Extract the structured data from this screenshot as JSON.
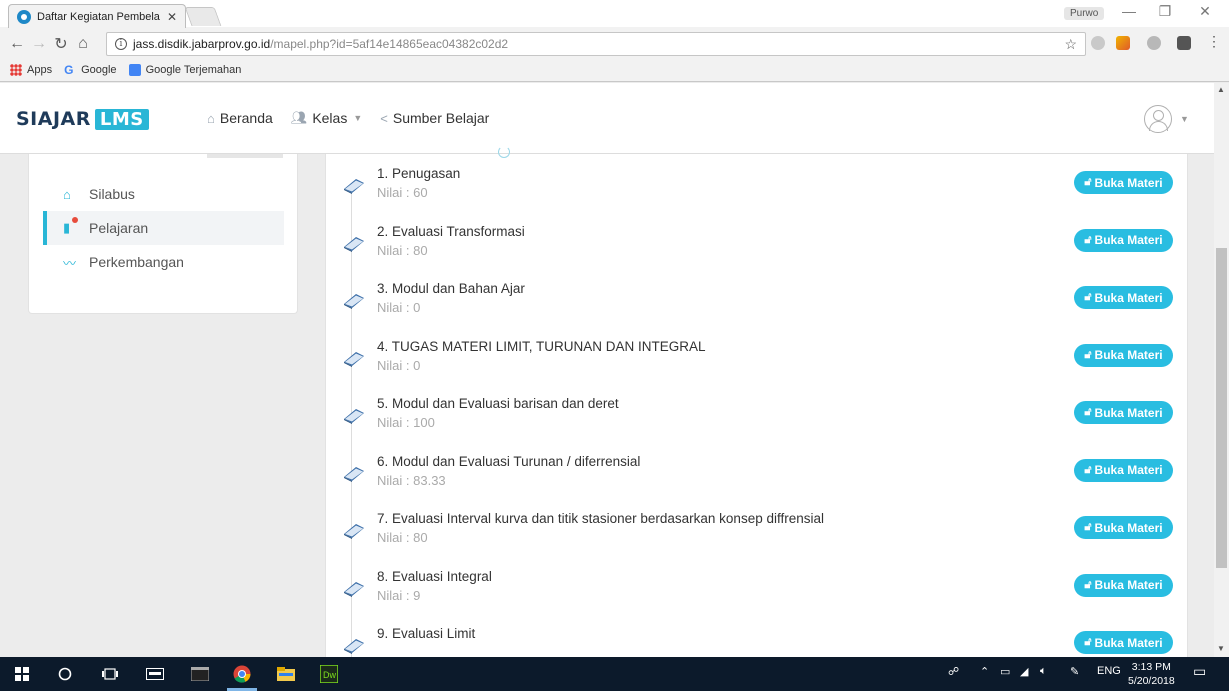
{
  "browser": {
    "tab_title": "Daftar Kegiatan Pembela",
    "tab_close": "✕",
    "user_name": "Purwo",
    "url_host": "jass.disdik.jabarprov.go.id",
    "url_path": "/mapel.php?id=5af14e14865eac04382c02d2",
    "bookmarks": [
      {
        "label": "Apps",
        "icon": "apps-grid-icon"
      },
      {
        "label": "Google",
        "icon": "google-g-icon"
      },
      {
        "label": "Google Terjemahan",
        "icon": "translate-icon"
      }
    ]
  },
  "navbar": {
    "brand_main": "SIAJAR",
    "brand_accent": "LMS",
    "menu": [
      {
        "label": "Beranda",
        "icon": "home-icon"
      },
      {
        "label": "Kelas",
        "icon": "users-icon",
        "dropdown": true
      },
      {
        "label": "Sumber Belajar",
        "icon": "share-icon"
      }
    ]
  },
  "sidebar": {
    "items": [
      {
        "label": "Silabus",
        "icon": "home-icon",
        "active": false
      },
      {
        "label": "Pelajaran",
        "icon": "book-icon",
        "active": true
      },
      {
        "label": "Perkembangan",
        "icon": "activity-icon",
        "active": false
      }
    ]
  },
  "lessons": {
    "button_label": "Buka Materi",
    "items": [
      {
        "title": "1. Penugasan",
        "score": "Nilai : 60"
      },
      {
        "title": "2. Evaluasi Transformasi",
        "score": "Nilai : 80"
      },
      {
        "title": "3. Modul dan Bahan Ajar",
        "score": "Nilai : 0"
      },
      {
        "title": "4. TUGAS MATERI LIMIT, TURUNAN DAN INTEGRAL",
        "score": "Nilai : 0"
      },
      {
        "title": "5. Modul dan Evaluasi barisan dan deret",
        "score": "Nilai : 100"
      },
      {
        "title": "6. Modul dan Evaluasi Turunan / diferrensial",
        "score": "Nilai : 83.33"
      },
      {
        "title": "7. Evaluasi Interval kurva dan titik stasioner berdasarkan konsep diffrensial",
        "score": "Nilai : 80"
      },
      {
        "title": "8. Evaluasi Integral",
        "score": "Nilai : 9"
      },
      {
        "title": "9. Evaluasi Limit",
        "score": ""
      }
    ]
  },
  "taskbar": {
    "language": "ENG",
    "time": "3:13 PM",
    "date": "5/20/2018"
  },
  "colors": {
    "accent": "#29bde1",
    "brand_dark": "#1f3b5a",
    "taskbar": "#0c1a2b"
  }
}
